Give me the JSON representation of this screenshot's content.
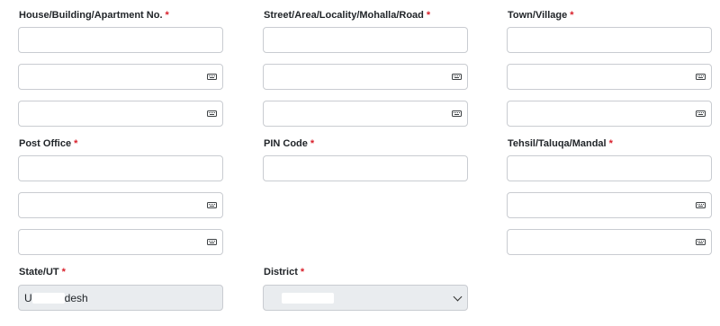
{
  "form": {
    "house": {
      "label": "House/Building/Apartment No.",
      "required_mark": "*"
    },
    "street": {
      "label": "Street/Area/Locality/Mohalla/Road",
      "required_mark": "*"
    },
    "town": {
      "label": "Town/Village",
      "required_mark": "*"
    },
    "post_office": {
      "label": "Post Office",
      "required_mark": "*"
    },
    "pin_code": {
      "label": "PIN Code",
      "required_mark": "*"
    },
    "tehsil": {
      "label": "Tehsil/Taluqa/Mandal",
      "required_mark": "*"
    },
    "state": {
      "label": "State/UT",
      "required_mark": "*",
      "value_prefix": "U",
      "value_suffix": "desh"
    },
    "district": {
      "label": "District",
      "required_mark": "*"
    }
  },
  "icons": {
    "keyboard": "keyboard-icon",
    "dropdown": "chevron-down-icon"
  },
  "colors": {
    "required": "#d9202b",
    "border": "#c9ccd1",
    "readonly_bg": "#e9ecef"
  }
}
